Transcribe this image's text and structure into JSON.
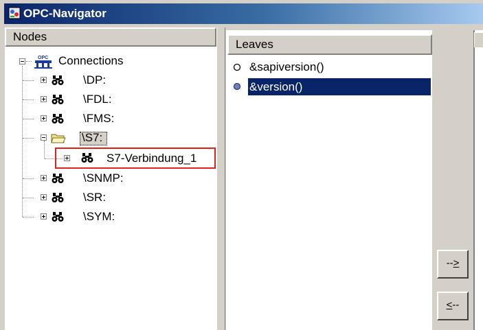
{
  "window": {
    "title": "OPC-Navigator"
  },
  "nodes_panel": {
    "header": "Nodes",
    "root": {
      "label": "Connections",
      "expanded": true,
      "icon": "opc-connections-icon"
    },
    "items": [
      {
        "label": "\\DP:",
        "icon": "binoculars-icon",
        "expanded": false
      },
      {
        "label": "\\FDL:",
        "icon": "binoculars-icon",
        "expanded": false
      },
      {
        "label": "\\FMS:",
        "icon": "binoculars-icon",
        "expanded": false
      },
      {
        "label": "\\S7:",
        "icon": "open-folder-icon",
        "expanded": true,
        "selected": true,
        "children": [
          {
            "label": "S7-Verbindung_1",
            "icon": "binoculars-icon",
            "expanded": false,
            "highlighted": true
          }
        ]
      },
      {
        "label": "\\SNMP:",
        "icon": "binoculars-icon",
        "expanded": false
      },
      {
        "label": "\\SR:",
        "icon": "binoculars-icon",
        "expanded": false
      },
      {
        "label": "\\SYM:",
        "icon": "binoculars-icon",
        "expanded": false
      }
    ]
  },
  "leaves_panel": {
    "header": "Leaves",
    "items": [
      {
        "label": "&sapiversion()",
        "selected": false
      },
      {
        "label": "&version()",
        "selected": true
      }
    ]
  },
  "buttons": {
    "add": {
      "prefix": "--",
      "accel": ">"
    },
    "remove": {
      "accel": "<",
      "suffix": "--"
    }
  },
  "colors": {
    "highlight_box": "#e02020",
    "selection": "#0a246a",
    "title_start": "#0a246a",
    "title_end": "#a6caf0"
  }
}
